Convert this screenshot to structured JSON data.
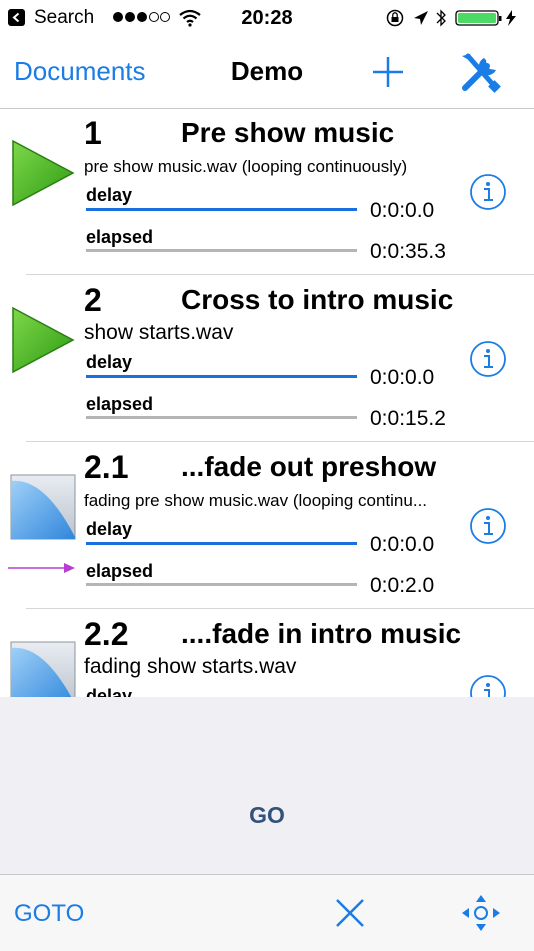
{
  "status_bar": {
    "back_app": "Search",
    "time": "20:28"
  },
  "nav": {
    "back_label": "Documents",
    "title": "Demo"
  },
  "cues": [
    {
      "number": "1",
      "name": "Pre show music",
      "file": "pre show music.wav (looping continuously)",
      "delay_label": "delay",
      "delay_value": "0:0:0.0",
      "elapsed_label": "elapsed",
      "elapsed_value": "0:0:35.3",
      "icon": "play-triangle-icon"
    },
    {
      "number": "2",
      "name": "Cross to intro music",
      "file": "show starts.wav",
      "delay_label": "delay",
      "delay_value": "0:0:0.0",
      "elapsed_label": "elapsed",
      "elapsed_value": "0:0:15.2",
      "icon": "play-triangle-icon"
    },
    {
      "number": "2.1",
      "name": "...fade out preshow",
      "file": "fading pre show music.wav (looping continu...",
      "delay_label": "delay",
      "delay_value": "0:0:0.0",
      "elapsed_label": "elapsed",
      "elapsed_value": "0:0:2.0",
      "icon": "fade-curve-icon"
    },
    {
      "number": "2.2",
      "name": "....fade in intro music",
      "file": "fading show starts.wav",
      "delay_label": "delay",
      "icon": "fade-curve-icon"
    }
  ],
  "go_panel": {
    "label": "GO"
  },
  "toolbar": {
    "goto_label": "GOTO"
  },
  "colors": {
    "accent": "#1a7ce5",
    "delay_bar": "#1a6fe0",
    "elapsed_bar": "#b5b5b5",
    "play_green": "#3fae1f",
    "arrow_purple": "#b63dd0",
    "go_text": "#33527a"
  }
}
